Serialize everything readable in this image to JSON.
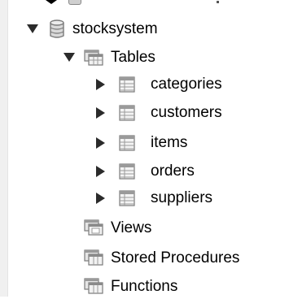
{
  "tree": {
    "schema": {
      "label": "stocksystem",
      "icon": "database-icon",
      "expanded": true
    },
    "tables_group": {
      "label": "Tables",
      "icon": "table-folder-icon",
      "expanded": true
    },
    "tables": [
      {
        "label": "categories",
        "icon": "table-icon"
      },
      {
        "label": "customers",
        "icon": "table-icon"
      },
      {
        "label": "items",
        "icon": "table-icon"
      },
      {
        "label": "orders",
        "icon": "table-icon"
      },
      {
        "label": "suppliers",
        "icon": "table-icon"
      }
    ],
    "views": {
      "label": "Views",
      "icon": "views-folder-icon"
    },
    "procedures": {
      "label": "Stored Procedures",
      "icon": "procedures-folder-icon"
    },
    "functions": {
      "label": "Functions",
      "icon": "functions-folder-icon"
    }
  },
  "colors": {
    "arrow": "#2b2b2b",
    "text": "#000000",
    "icon_border": "#7a7a7a",
    "icon_fill": "#d9d9d9"
  }
}
